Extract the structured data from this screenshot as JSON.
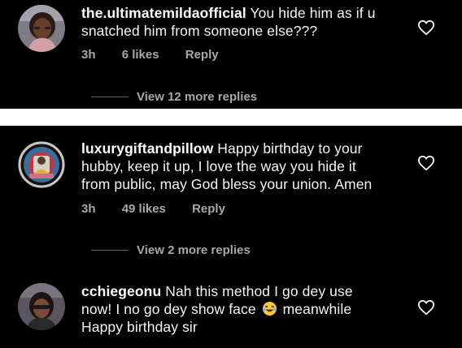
{
  "comments": [
    {
      "username": "the.ultimatemildaofficial",
      "text_line1": " You hide him as if u",
      "text_line2": "snatched him from someone else???",
      "time": "3h",
      "likes": "6 likes",
      "reply": "Reply",
      "view_more": "View 12 more replies"
    },
    {
      "username": "luxurygiftandpillow",
      "text_line1": " Happy birthday to your",
      "text_line2": "hubby, keep it up, I love the way you hide it",
      "text_line3": "from public, may God bless your union. Amen",
      "time": "3h",
      "likes": "49 likes",
      "reply": "Reply",
      "view_more": "View 2 more replies"
    },
    {
      "username": "cchiegeonu",
      "text_line1": " Nah this method I go dey use",
      "text_line2a": "now! I no go dey show face",
      "emoji_name": "laughing-emoji",
      "text_line2b": "meanwhile",
      "text_line3": "Happy birthday sir"
    }
  ],
  "icons": {
    "like": "heart-outline-icon"
  },
  "colors": {
    "background": "#000000",
    "text": "#f5f5f5",
    "meta": "#a8a8a8",
    "divider": "#ffffff"
  }
}
